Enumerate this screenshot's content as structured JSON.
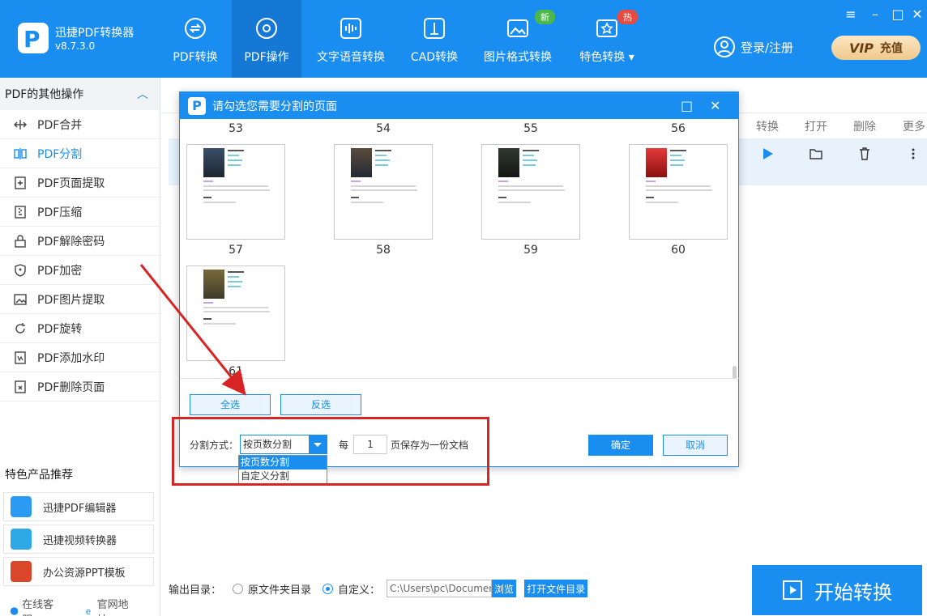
{
  "app": {
    "name": "迅捷PDF转换器",
    "version": "v8.7.3.0",
    "logo_letter": "P"
  },
  "nav": {
    "items": [
      {
        "label": "PDF转换",
        "icon": "pdf-convert-icon",
        "active": false
      },
      {
        "label": "PDF操作",
        "icon": "pdf-operate-icon",
        "active": true
      },
      {
        "label": "文字语音转换",
        "icon": "voice-icon",
        "active": false
      },
      {
        "label": "CAD转换",
        "icon": "cad-icon",
        "active": false
      },
      {
        "label": "图片格式转换",
        "icon": "image-icon",
        "active": false,
        "badge": "新"
      },
      {
        "label": "特色转换",
        "icon": "special-icon",
        "active": false,
        "badge": "热"
      }
    ],
    "login": "登录/注册",
    "vip": "VIP",
    "recharge": "充值"
  },
  "sidebar": {
    "header": "PDF的其他操作",
    "items": [
      {
        "label": "PDF合并",
        "icon": "merge-icon"
      },
      {
        "label": "PDF分割",
        "icon": "split-icon",
        "active": true
      },
      {
        "label": "PDF页面提取",
        "icon": "extract-page-icon"
      },
      {
        "label": "PDF压缩",
        "icon": "compress-icon"
      },
      {
        "label": "PDF解除密码",
        "icon": "unlock-icon"
      },
      {
        "label": "PDF加密",
        "icon": "shield-icon"
      },
      {
        "label": "PDF图片提取",
        "icon": "image-extract-icon"
      },
      {
        "label": "PDF旋转",
        "icon": "rotate-icon"
      },
      {
        "label": "PDF添加水印",
        "icon": "watermark-icon"
      },
      {
        "label": "PDF删除页面",
        "icon": "delete-page-icon"
      }
    ],
    "featured_title": "特色产品推荐",
    "featured": [
      {
        "label": "迅捷PDF编辑器",
        "color": "#2b9af3"
      },
      {
        "label": "迅捷视频转换器",
        "color": "#2fa9e6"
      },
      {
        "label": "办公资源PPT模板",
        "color": "#d9462a"
      }
    ],
    "footer": {
      "service": "在线客服",
      "website": "官网地址"
    }
  },
  "main": {
    "columns": [
      "转换",
      "打开",
      "删除",
      "更多"
    ],
    "output_label": "输出目录：",
    "option_source": "原文件夹目录",
    "option_custom": "自定义：",
    "path": "C:\\Users\\pc\\Documen",
    "browse": "浏览",
    "open_dir": "打开文件目录",
    "start": "开始转换"
  },
  "dialog": {
    "title": "请勾选您需要分割的页面",
    "pages": [
      "53",
      "54",
      "55",
      "56",
      "57",
      "58",
      "59",
      "60",
      "61"
    ],
    "select_all": "全选",
    "invert": "反选",
    "split_label": "分割方式：",
    "split_value": "按页数分割",
    "every": "每",
    "count": "1",
    "suffix": "页保存为一份文档",
    "ok": "确定",
    "cancel": "取消",
    "options": [
      "按页数分割",
      "自定义分割"
    ]
  },
  "colors": {
    "primary": "#1a8ef0",
    "annotation": "#d82424"
  }
}
